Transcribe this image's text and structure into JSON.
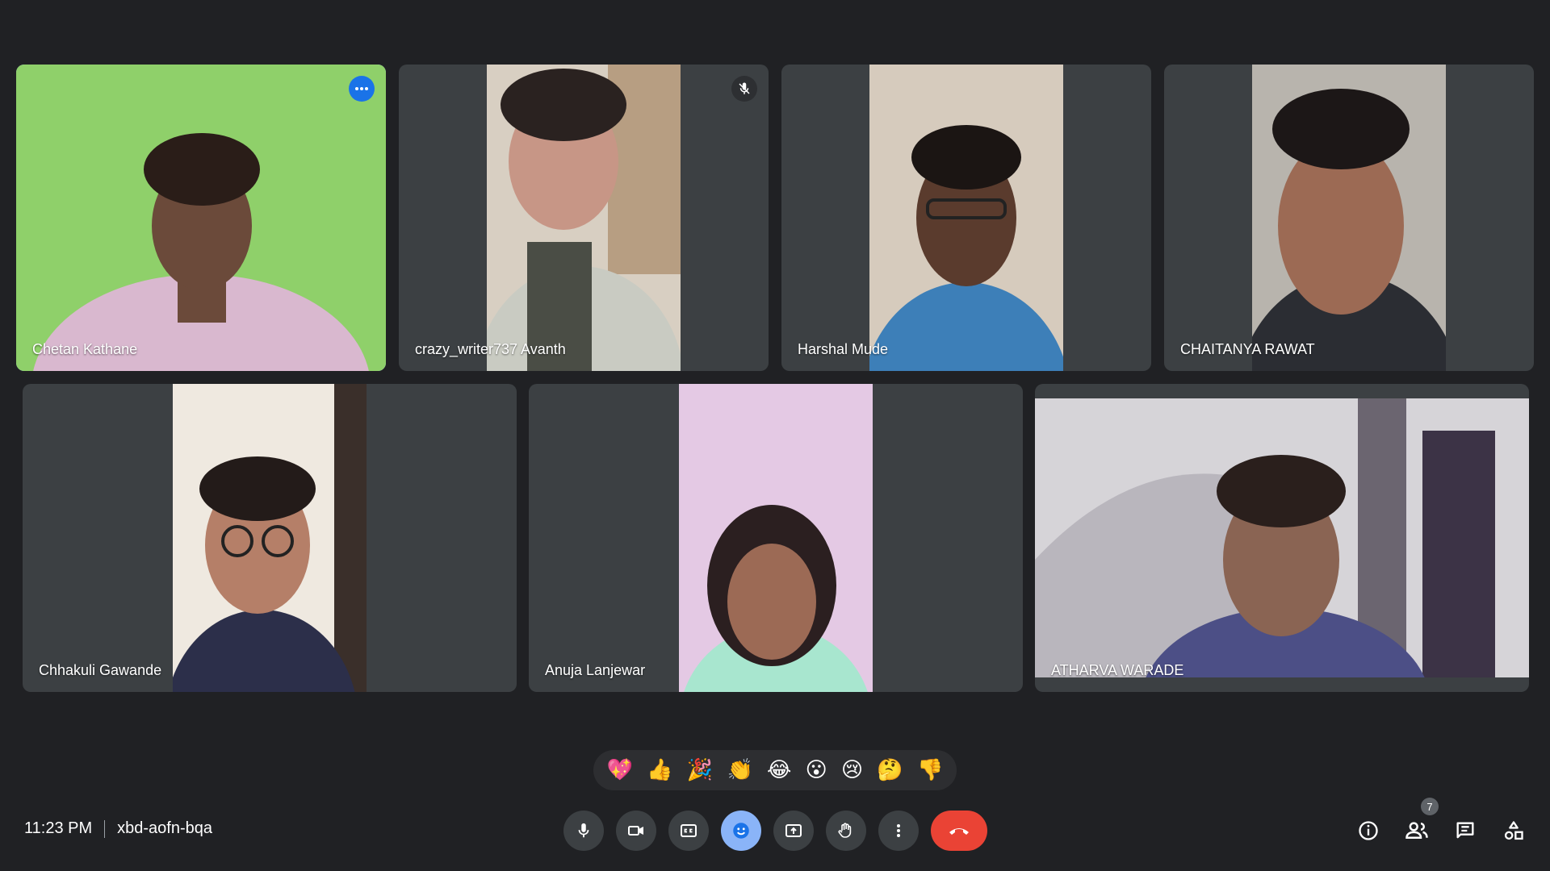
{
  "participants": [
    {
      "name": "Chetan Kathane"
    },
    {
      "name": "crazy_writer737 Avanth"
    },
    {
      "name": "Harshal Mude"
    },
    {
      "name": "CHAITANYA RAWAT"
    },
    {
      "name": "Chhakuli Gawande"
    },
    {
      "name": "Anuja Lanjewar"
    },
    {
      "name": "ATHARVA WARADE"
    }
  ],
  "reactions": [
    "💖",
    "👍",
    "🎉",
    "👏",
    "😂",
    "😮",
    "😢",
    "🤔",
    "👎"
  ],
  "footer": {
    "time": "11:23 PM",
    "meeting_code": "xbd-aofn-bqa",
    "people_count": "7"
  },
  "colors": {
    "background": "#202124",
    "tile": "#3c4043",
    "active_outline": "#8ab4f8",
    "hangup": "#ea4335"
  },
  "icons": [
    "mic-icon",
    "camera-icon",
    "captions-icon",
    "emoji-icon",
    "present-icon",
    "raise-hand-icon",
    "more-vert-icon",
    "hangup-icon",
    "info-icon",
    "people-icon",
    "chat-icon",
    "activities-icon",
    "muted-mic-icon",
    "more-horiz-icon"
  ]
}
